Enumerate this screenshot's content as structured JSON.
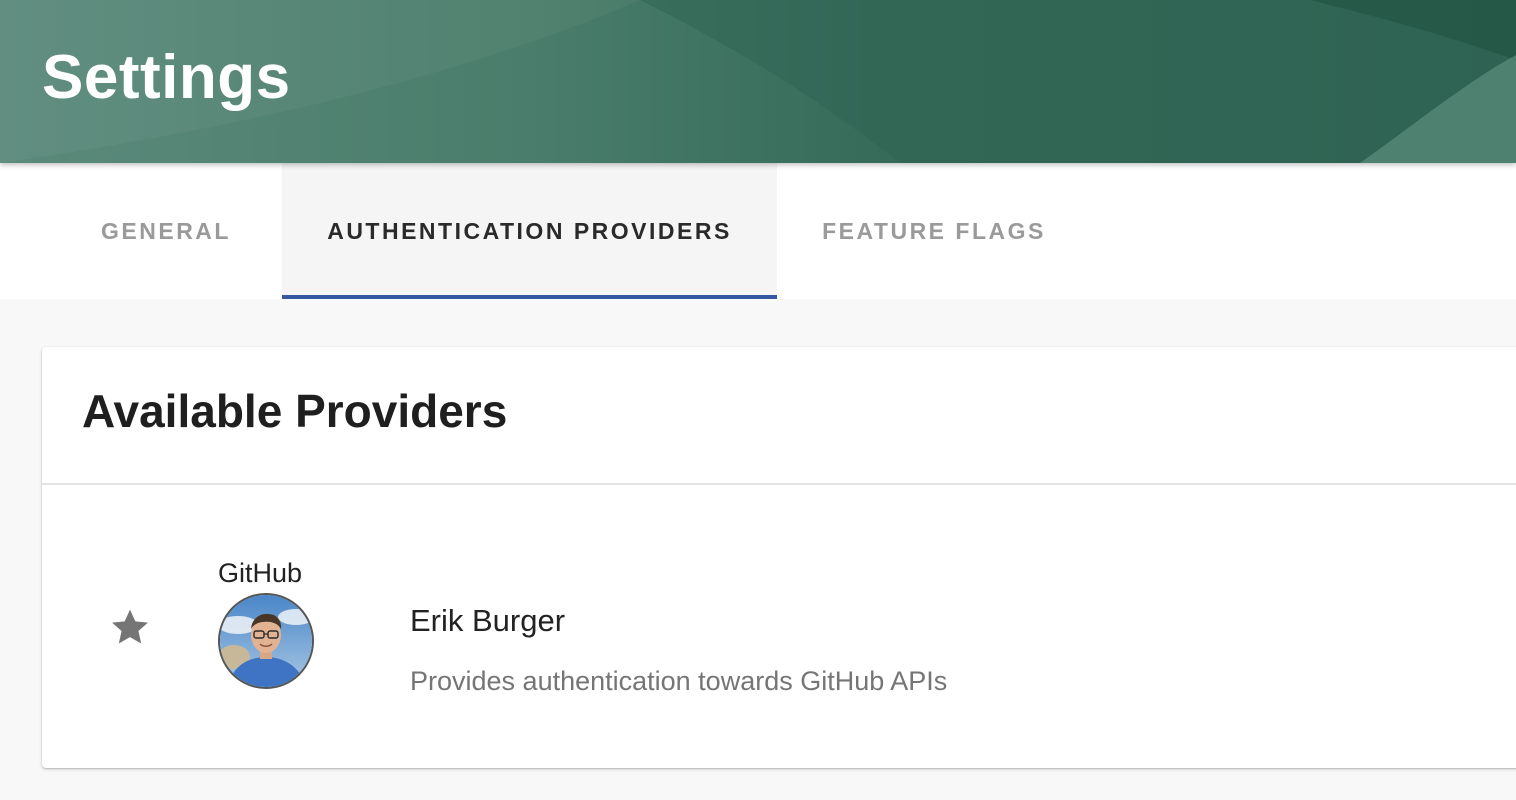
{
  "header": {
    "title": "Settings",
    "colors": {
      "primary": "#356958",
      "text": "#ffffff"
    }
  },
  "tabs": [
    {
      "label": "GENERAL",
      "active": false
    },
    {
      "label": "AUTHENTICATION PROVIDERS",
      "active": true
    },
    {
      "label": "FEATURE FLAGS",
      "active": false
    }
  ],
  "accent_color": "#3556a1",
  "card": {
    "title": "Available Providers",
    "provider": {
      "star_icon": "star-icon",
      "name": "GitHub",
      "avatar_icon": "user-avatar",
      "user_name": "Erik Burger",
      "description": "Provides authentication towards GitHub APIs"
    }
  }
}
